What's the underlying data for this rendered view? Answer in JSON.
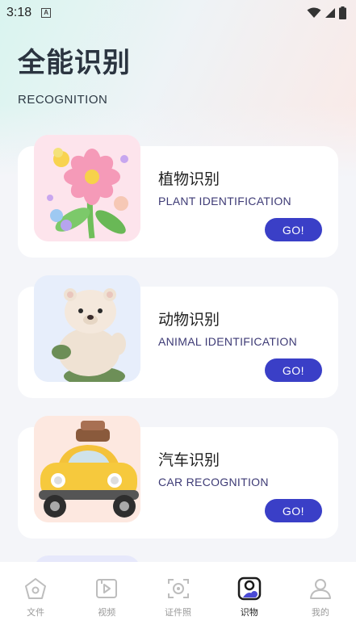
{
  "status_bar": {
    "time": "3:18",
    "notification_icon": "A"
  },
  "header": {
    "title": "全能识别",
    "subtitle": "RECOGNITION"
  },
  "cards": [
    {
      "title": "植物识别",
      "subtitle": "PLANT IDENTIFICATION",
      "button": "GO!",
      "image": "flower-illustration",
      "bg": "#fde4ec"
    },
    {
      "title": "动物识别",
      "subtitle": "ANIMAL IDENTIFICATION",
      "button": "GO!",
      "image": "bear-illustration",
      "bg": "#e7eefb"
    },
    {
      "title": "汽车识别",
      "subtitle": "CAR RECOGNITION",
      "button": "GO!",
      "image": "car-illustration",
      "bg": "#fde8e0"
    }
  ],
  "tabbar": {
    "items": [
      {
        "label": "文件",
        "icon": "file-icon",
        "active": false
      },
      {
        "label": "视频",
        "icon": "video-icon",
        "active": false
      },
      {
        "label": "证件照",
        "icon": "id-photo-icon",
        "active": false
      },
      {
        "label": "识物",
        "icon": "recognize-icon",
        "active": true
      },
      {
        "label": "我的",
        "icon": "profile-icon",
        "active": false
      }
    ]
  },
  "colors": {
    "accent": "#3a3fc7",
    "title": "#2b3440",
    "subtitle_text": "#3d3a75"
  }
}
